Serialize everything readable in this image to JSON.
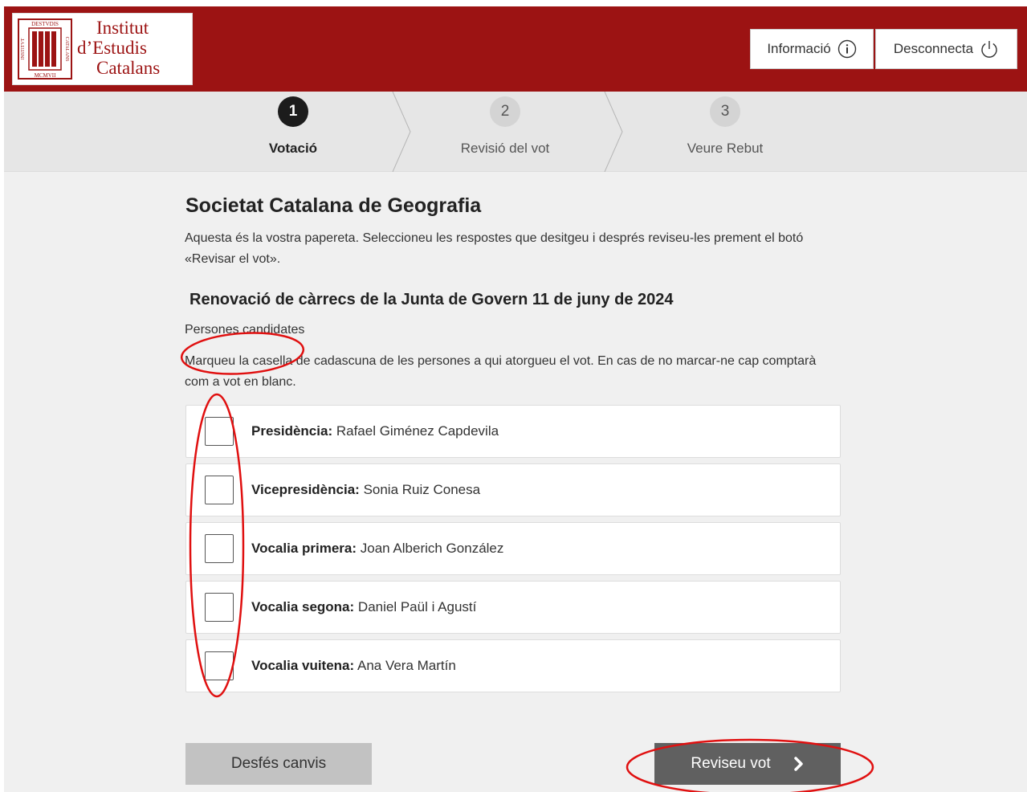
{
  "logo": {
    "line1": "Institut",
    "line2": "d’Estudis",
    "line3": "Catalans",
    "seal_text": "DESTVDIS CATALANS INSTITVT MCMVII"
  },
  "header": {
    "info_label": "Informació",
    "logout_label": "Desconnecta",
    "bg_color": "#9c1313"
  },
  "stepper": {
    "steps": [
      {
        "number": "1",
        "label": "Votació",
        "active": true
      },
      {
        "number": "2",
        "label": "Revisió del vot",
        "active": false
      },
      {
        "number": "3",
        "label": "Veure Rebut",
        "active": false
      }
    ]
  },
  "ballot": {
    "org_title": "Societat Catalana de Geografia",
    "intro": "Aquesta és la vostra papereta. Seleccioneu les respostes que desitgeu i després reviseu-les prement el botó «Revisar el vot».",
    "election_title": "Renovació de càrrecs de la Junta de Govern 11 de juny de 2024",
    "candidates_label": "Persones candidates",
    "instructions": "Marqueu la casella de cadascuna de les persones a qui atorgueu el vot. En cas de no marcar-ne cap comptarà com a vot en blanc.",
    "options": [
      {
        "role": "Presidència:",
        "name": "Rafael Giménez Capdevila",
        "checked": false
      },
      {
        "role": "Vicepresidència:",
        "name": "Sonia Ruiz Conesa",
        "checked": false
      },
      {
        "role": "Vocalia primera:",
        "name": "Joan Alberich González",
        "checked": false
      },
      {
        "role": "Vocalia segona:",
        "name": "Daniel Paül i Agustí",
        "checked": false
      },
      {
        "role": "Vocalia vuitena:",
        "name": "Ana Vera Martín",
        "checked": false
      }
    ]
  },
  "actions": {
    "undo_label": "Desfés canvis",
    "review_label": "Reviseu vot"
  },
  "annotation_color": "#e01010"
}
